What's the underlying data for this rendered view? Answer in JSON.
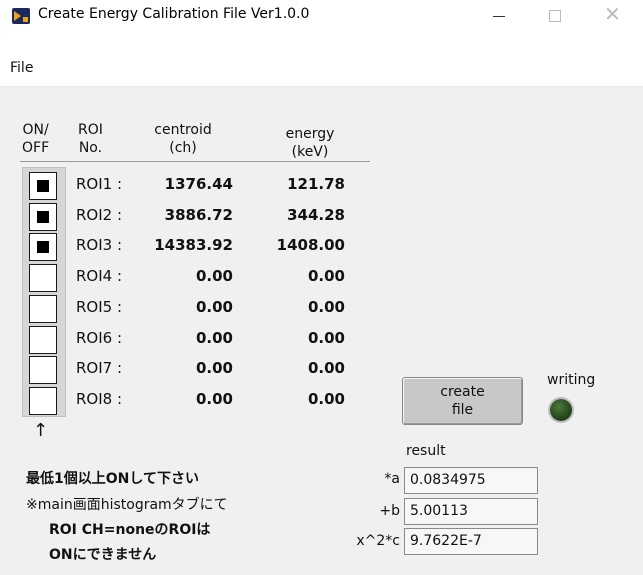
{
  "window": {
    "title": "Create Energy Calibration File  Ver1.0.0",
    "minimize_glyph": "—",
    "maximize_glyph": "☐",
    "close_glyph": "✕"
  },
  "menu": {
    "file": "File"
  },
  "headers": {
    "onoff_1": "ON/",
    "onoff_2": "OFF",
    "roi_1": "ROI",
    "roi_2": "No.",
    "centroid_1": "centroid",
    "centroid_2": "(ch)",
    "energy_1": "energy",
    "energy_2": "(keV)"
  },
  "rows": [
    {
      "label": "ROI1 :",
      "checked": true,
      "centroid": "1376.44",
      "energy": "121.78"
    },
    {
      "label": "ROI2 :",
      "checked": true,
      "centroid": "3886.72",
      "energy": "344.28"
    },
    {
      "label": "ROI3 :",
      "checked": true,
      "centroid": "14383.92",
      "energy": "1408.00"
    },
    {
      "label": "ROI4 :",
      "checked": false,
      "centroid": "0.00",
      "energy": "0.00"
    },
    {
      "label": "ROI5 :",
      "checked": false,
      "centroid": "0.00",
      "energy": "0.00"
    },
    {
      "label": "ROI6 :",
      "checked": false,
      "centroid": "0.00",
      "energy": "0.00"
    },
    {
      "label": "ROI7 :",
      "checked": false,
      "centroid": "0.00",
      "energy": "0.00"
    },
    {
      "label": "ROI8 :",
      "checked": false,
      "centroid": "0.00",
      "energy": "0.00"
    }
  ],
  "notes": {
    "arrow": "↑",
    "line1": "最低1個以上ONして下さい",
    "line2": "※main画面histogramタブにて",
    "line3": "ROI CH=noneのROIは",
    "line4": "ONにできません"
  },
  "create_button": {
    "line1": "create",
    "line2": "file"
  },
  "writing": {
    "label": "writing",
    "led_color": "#2f5a23"
  },
  "result": {
    "label": "result",
    "a_label": "*a",
    "a_value": "0.0834975",
    "b_label": "+b",
    "b_value": "5.00113",
    "c_label": "x^2*c",
    "c_value": "9.7622E-7"
  },
  "colors": {
    "panel_bg": "#f0f0f0",
    "titlebar_bg": "#ffffff",
    "checkbox_mark": "#000000"
  }
}
